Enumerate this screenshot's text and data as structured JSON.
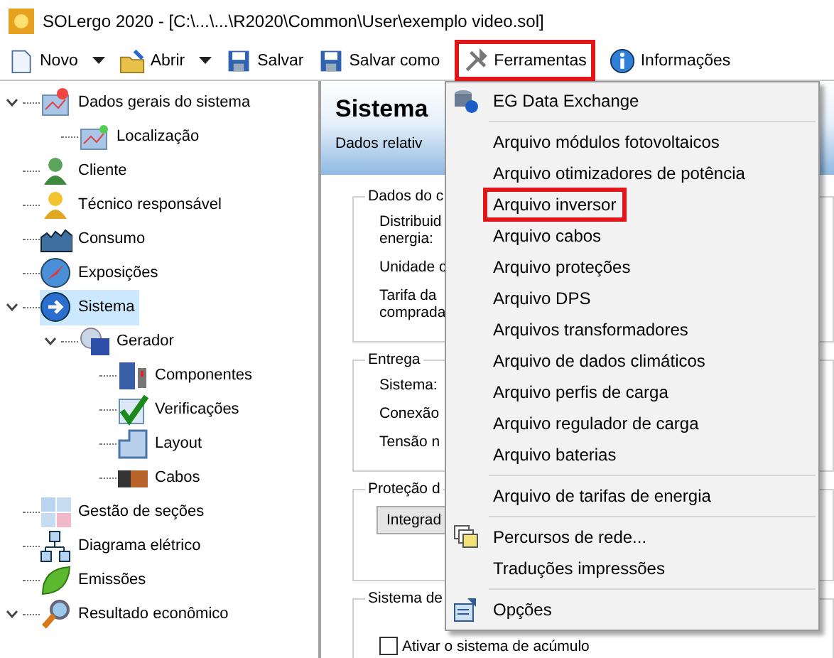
{
  "window": {
    "title": "SOLergo 2020 - [C:\\...\\...\\R2020\\Common\\User\\exemplo video.sol]"
  },
  "toolbar": [
    {
      "label": "Novo",
      "dropdown": true,
      "highlighted": false
    },
    {
      "label": "Abrir",
      "dropdown": true,
      "highlighted": false
    },
    {
      "label": "Salvar",
      "dropdown": false,
      "highlighted": false
    },
    {
      "label": "Salvar como",
      "dropdown": false,
      "highlighted": false
    },
    {
      "label": "Ferramentas",
      "dropdown": false,
      "highlighted": true
    },
    {
      "label": "Informações",
      "dropdown": false,
      "highlighted": false
    }
  ],
  "tree": [
    {
      "label": "Dados gerais do sistema",
      "expanded": true,
      "selected": false,
      "children": [
        {
          "label": "Localização",
          "selected": false
        }
      ]
    },
    {
      "label": "Cliente",
      "selected": false
    },
    {
      "label": "Técnico responsável",
      "selected": false
    },
    {
      "label": "Consumo",
      "selected": false
    },
    {
      "label": "Exposições",
      "selected": false
    },
    {
      "label": "Sistema",
      "expanded": true,
      "selected": true,
      "children": [
        {
          "label": "Gerador",
          "expanded": true,
          "selected": false,
          "children": [
            {
              "label": "Componentes",
              "selected": false
            },
            {
              "label": "Verificações",
              "selected": false
            },
            {
              "label": "Layout",
              "selected": false
            },
            {
              "label": "Cabos",
              "selected": false
            }
          ]
        }
      ]
    },
    {
      "label": "Gestão de seções",
      "selected": false
    },
    {
      "label": "Diagrama elétrico",
      "selected": false
    },
    {
      "label": "Emissões",
      "selected": false
    },
    {
      "label": "Resultado econômico",
      "expanded": true,
      "selected": false
    }
  ],
  "panel": {
    "title": "Sistema",
    "subtitle": "Dados relativ",
    "groups": [
      {
        "title": "Dados do c",
        "labels": [
          "Distribuid\nenergia:",
          "Unidade c",
          "Tarifa da\ncomprada"
        ]
      },
      {
        "title": "Entrega",
        "labels": [
          "Sistema:",
          "Conexão",
          "Tensão n"
        ]
      },
      {
        "title": "Proteção d",
        "dropdown": "Integrad"
      },
      {
        "title": "Sistema de",
        "checkbox": {
          "label": "Ativar o sistema de acúmulo",
          "checked": false
        }
      }
    ]
  },
  "menu": [
    {
      "label": "EG Data Exchange",
      "separator_before": false,
      "highlighted": false
    },
    {
      "label": "Arquivo módulos fotovoltaicos",
      "separator_before": true,
      "highlighted": false
    },
    {
      "label": "Arquivo otimizadores de potência",
      "separator_before": false,
      "highlighted": false
    },
    {
      "label": "Arquivo inversor",
      "separator_before": false,
      "highlighted": true
    },
    {
      "label": "Arquivo cabos",
      "separator_before": false,
      "highlighted": false
    },
    {
      "label": "Arquivo proteções",
      "separator_before": false,
      "highlighted": false
    },
    {
      "label": "Arquivo DPS",
      "separator_before": false,
      "highlighted": false
    },
    {
      "label": "Arquivos transformadores",
      "separator_before": false,
      "highlighted": false
    },
    {
      "label": "Arquivo de dados climáticos",
      "separator_before": false,
      "highlighted": false
    },
    {
      "label": "Arquivo perfis de carga",
      "separator_before": false,
      "highlighted": false
    },
    {
      "label": "Arquivo regulador de carga",
      "separator_before": false,
      "highlighted": false
    },
    {
      "label": "Arquivo baterias",
      "separator_before": false,
      "highlighted": false
    },
    {
      "label": "Arquivo de tarifas de energia",
      "separator_before": true,
      "highlighted": false
    },
    {
      "label": "Percursos de rede...",
      "separator_before": true,
      "highlighted": false
    },
    {
      "label": "Traduções impressões",
      "separator_before": false,
      "highlighted": false
    },
    {
      "label": "Opções",
      "separator_before": true,
      "highlighted": false
    }
  ]
}
